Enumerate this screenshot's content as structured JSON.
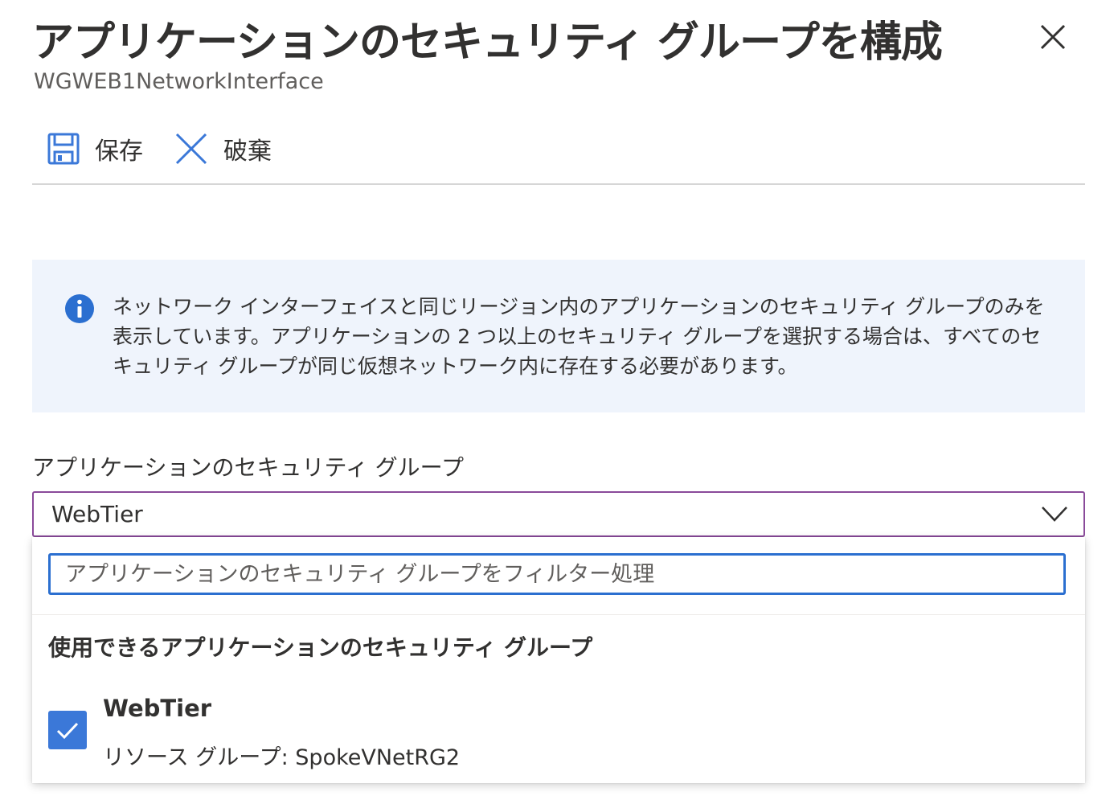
{
  "header": {
    "title": "アプリケーションのセキュリティ グループを構成",
    "subtitle": "WGWEB1NetworkInterface",
    "close_icon": "close-icon"
  },
  "toolbar": {
    "save_label": "保存",
    "save_icon": "save-icon",
    "discard_label": "破棄",
    "discard_icon": "discard-icon"
  },
  "info": {
    "icon": "info-icon",
    "text": "ネットワーク インターフェイスと同じリージョン内のアプリケーションのセキュリティ グループのみを表示しています。アプリケーションの 2 つ以上のセキュリティ グループを選択する場合は、すべてのセキュリティ グループが同じ仮想ネットワーク内に存在する必要があります。"
  },
  "field": {
    "label": "アプリケーションのセキュリティ グループ",
    "selected_value": "WebTier"
  },
  "dropdown": {
    "filter_placeholder": "アプリケーションのセキュリティ グループをフィルター処理",
    "filter_value": "",
    "section_heading": "使用できるアプリケーションのセキュリティ グループ",
    "options": [
      {
        "name": "WebTier",
        "subtitle": "リソース グループ: SpokeVNetRG2",
        "checked": true
      }
    ]
  },
  "colors": {
    "accent": "#3b78d8",
    "select_border": "#8a4a9a",
    "info_bg": "#eff4fc",
    "filter_border": "#2b6fd0"
  }
}
